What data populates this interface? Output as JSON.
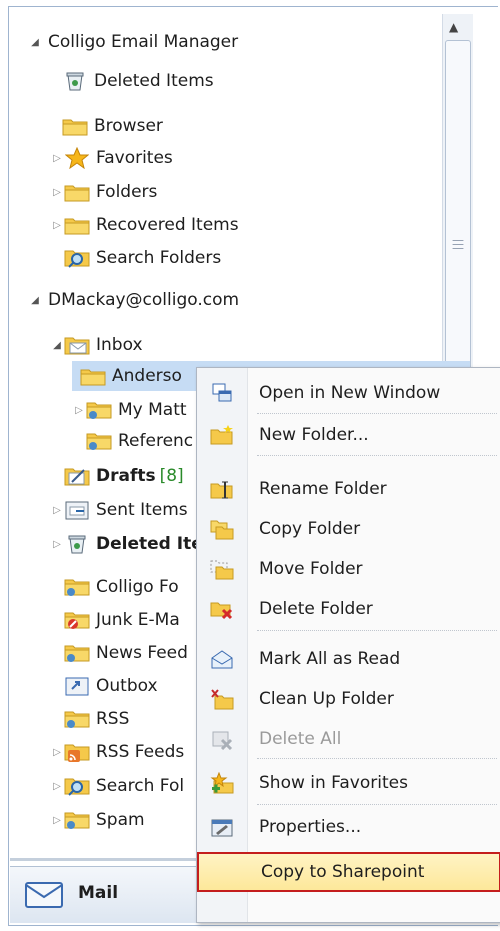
{
  "tree": {
    "colligo_root": "Colligo Email Manager",
    "colligo_items": [
      "Deleted Items",
      "Browser",
      "Favorites",
      "Folders",
      "Recovered Items",
      "Search Folders"
    ],
    "account_root": "DMackay@colligo.com",
    "inbox": "Inbox",
    "inbox_children": [
      "Anderso",
      "My Matt",
      "Referenc"
    ],
    "drafts": "Drafts",
    "drafts_count": "[8]",
    "sent": "Sent Items",
    "deleted": "Deleted Ite",
    "colligo_fo": "Colligo Fo",
    "junk": "Junk E-Ma",
    "news": "News Feed",
    "outbox": "Outbox",
    "rss": "RSS",
    "rss_feeds": "RSS Feeds",
    "search_fol": "Search Fol",
    "spam": "Spam"
  },
  "context_menu": {
    "items": [
      "Open in New Window",
      "New Folder...",
      "Rename Folder",
      "Copy Folder",
      "Move Folder",
      "Delete Folder",
      "Mark All as Read",
      "Clean Up Folder",
      "Delete All",
      "Show in Favorites",
      "Properties...",
      "Copy to Sharepoint"
    ]
  },
  "nav": {
    "mail_label": "Mail"
  },
  "colors": {
    "selection": "#c6dcf4",
    "highlight_border": "#c41d1d",
    "highlight_fill": "#fde89a",
    "folder": "#f5c94a"
  }
}
